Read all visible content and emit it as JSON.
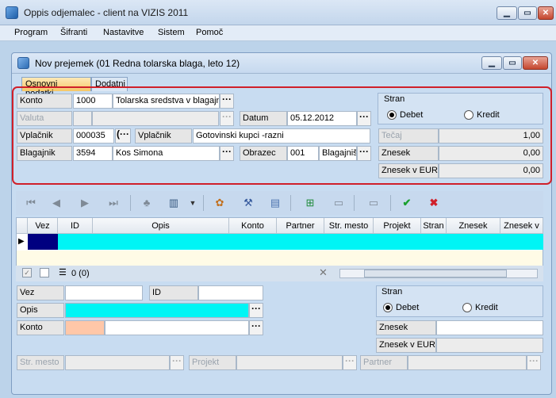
{
  "window": {
    "title": "Oppis odjemalec - client na VIZIS 2011"
  },
  "menu": [
    "Program",
    "Šifranti",
    "Nastavitve",
    "Sistem",
    "Pomoč"
  ],
  "subwindow": {
    "title": "Nov prejemek (01 Redna tolarska blaga, leto 12)"
  },
  "tabs": {
    "active": "Osnovni podatki",
    "other": "Dodatni"
  },
  "header": {
    "konto_label": "Konto",
    "konto_value": "1000",
    "konto_desc": "Tolarska sredstva v blagajni",
    "valuta_label": "Valuta",
    "datum_label": "Datum",
    "datum_value": "05.12.2012",
    "vplacnik_label": "Vplačnik",
    "vplacnik_value": "000035",
    "vplacnik_label2": "Vplačnik",
    "vplacnik_desc": "Gotovinski kupci -razni",
    "blagajnik_label": "Blagajnik",
    "blagajnik_value": "3594",
    "blagajnik_desc": "Kos Simona",
    "obrazec_label": "Obrazec",
    "obrazec_value": "001",
    "obrazec_desc": "Blagajnišk"
  },
  "strana": {
    "label": "Stran",
    "debet": "Debet",
    "kredit": "Kredit"
  },
  "amounts": {
    "tecaj_label": "Tečaj",
    "tecaj_value": "1,00",
    "znesek_label": "Znesek",
    "znesek_value": "0,00",
    "eur_label": "Znesek v EUR",
    "eur_value": "0,00"
  },
  "grid": {
    "columns": [
      "Vez",
      "ID",
      "Opis",
      "Konto",
      "Partner",
      "Str. mesto",
      "Projekt",
      "Stran",
      "Znesek",
      "Znesek v"
    ],
    "count": "0 (0)"
  },
  "detail": {
    "vez_label": "Vez",
    "id_label": "ID",
    "opis_label": "Opis",
    "konto_label": "Konto",
    "strana_label": "Stran",
    "debet": "Debet",
    "kredit": "Kredit",
    "znesek_label": "Znesek",
    "eur_label": "Znesek v EUR",
    "strmesto_label": "Str. mesto",
    "projekt_label": "Projekt",
    "partner_label": "Partner"
  },
  "colors": {
    "accent_red": "#d0202a",
    "selection": "#00f5f5",
    "tab_active": "#f6c767"
  }
}
